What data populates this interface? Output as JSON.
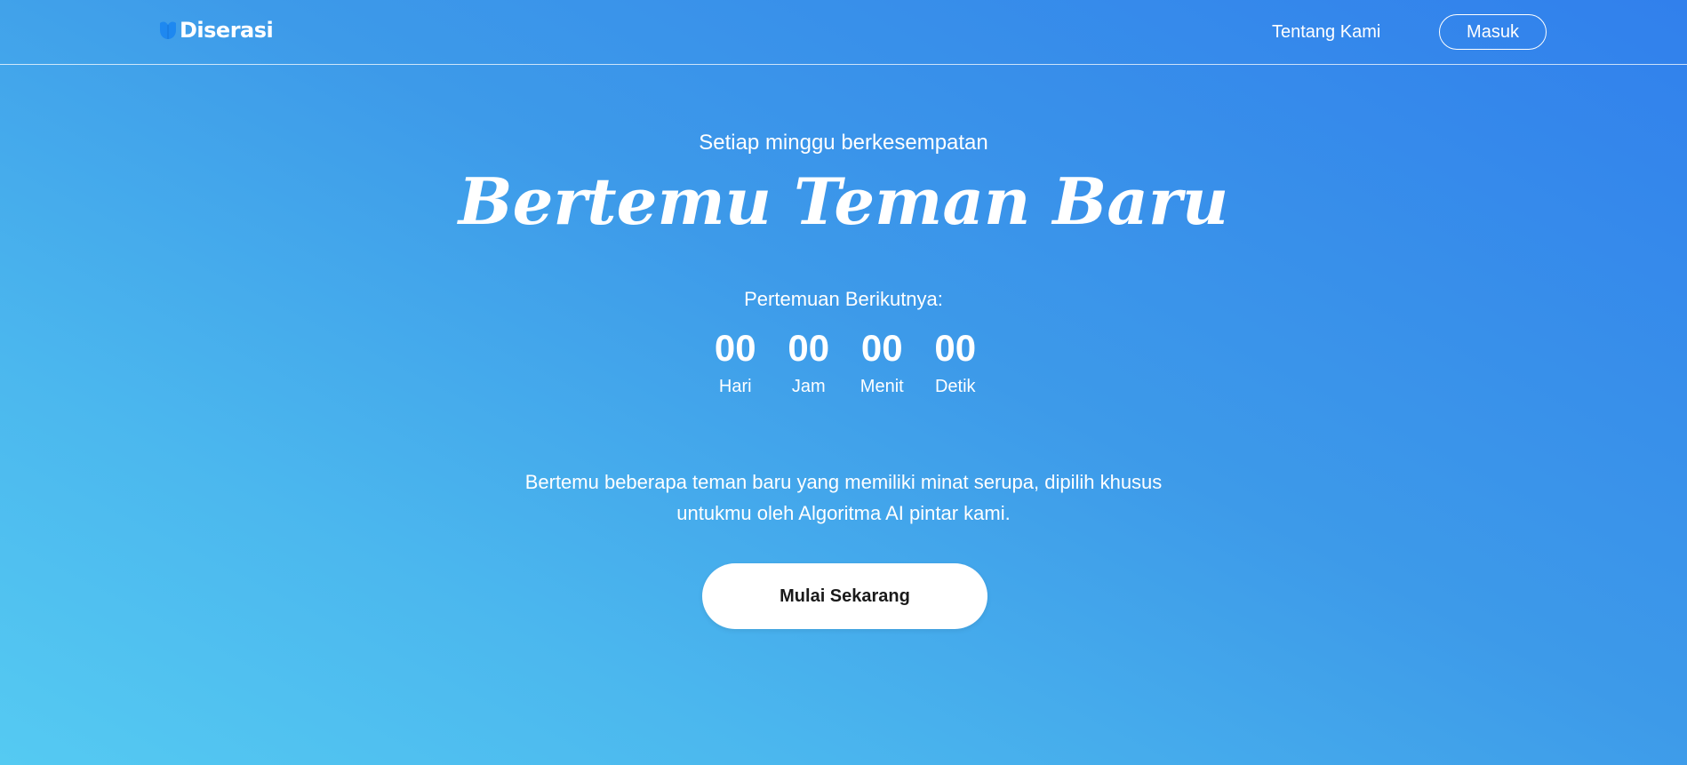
{
  "brand": {
    "name": "Diserasi",
    "logo_icon": "tulip-drop-icon",
    "logo_color": "#1e88f0"
  },
  "nav": {
    "about_label": "Tentang Kami",
    "login_label": "Masuk"
  },
  "hero": {
    "kicker": "Setiap minggu berkesempatan",
    "headline": "Bertemu Teman Baru",
    "countdown_label": "Pertemuan Berikutnya:",
    "countdown": [
      {
        "value": "00",
        "label": "Hari"
      },
      {
        "value": "00",
        "label": "Jam"
      },
      {
        "value": "00",
        "label": "Menit"
      },
      {
        "value": "00",
        "label": "Detik"
      }
    ],
    "description_line1": "Bertemu beberapa teman baru yang memiliki minat serupa, dipilih khusus",
    "description_line2": "untukmu oleh Algoritma AI pintar kami.",
    "cta_label": "Mulai Sekarang"
  },
  "colors": {
    "gradient_top": "#3180ec",
    "gradient_bottom": "#55caf2",
    "cta_background": "#ffffff",
    "cta_text": "#1a1a1a"
  }
}
